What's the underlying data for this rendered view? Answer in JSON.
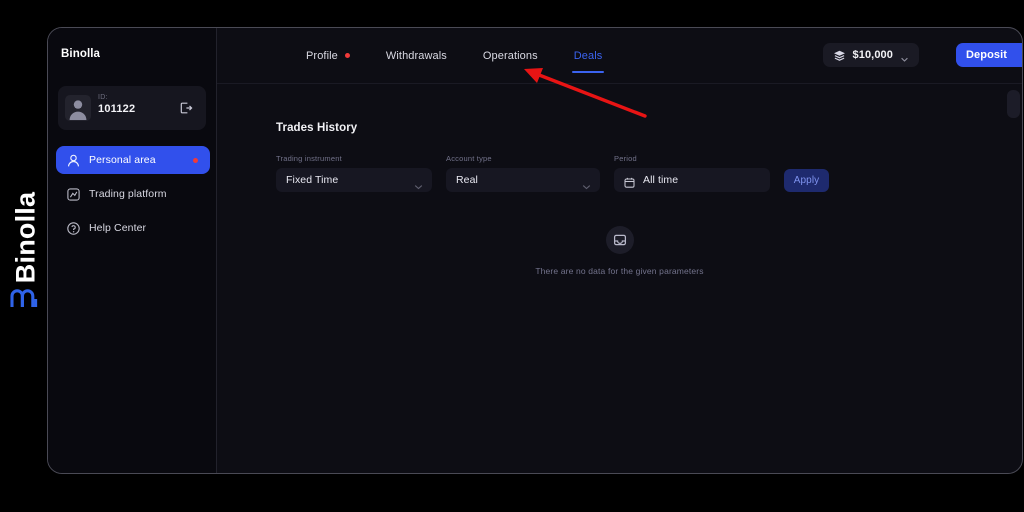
{
  "watermark": {
    "text": "Binolla",
    "logo_icon": "binolla-arch-logo"
  },
  "sidebar": {
    "brand": "Binolla",
    "account": {
      "id_label": "ID:",
      "id_value": "101122",
      "avatar_icon": "user-avatar-icon",
      "logout_icon": "logout-icon"
    },
    "items": [
      {
        "label": "Personal area",
        "icon": "person-icon",
        "active": true,
        "badge": true
      },
      {
        "label": "Trading platform",
        "icon": "chart-square-icon",
        "active": false,
        "badge": false
      },
      {
        "label": "Help Center",
        "icon": "question-circle-icon",
        "active": false,
        "badge": false
      }
    ]
  },
  "topbar": {
    "tabs": [
      {
        "label": "Profile",
        "active": false,
        "dot": true
      },
      {
        "label": "Withdrawals",
        "active": false,
        "dot": false
      },
      {
        "label": "Operations",
        "active": false,
        "dot": false
      },
      {
        "label": "Deals",
        "active": true,
        "dot": false
      }
    ],
    "balance": {
      "amount": "$10,000",
      "icon": "coins-stack-icon",
      "caret_icon": "chevron-down-icon"
    },
    "deposit_label": "Deposit"
  },
  "main": {
    "title": "Trades History",
    "filters": {
      "instrument": {
        "label": "Trading instrument",
        "value": "Fixed Time",
        "caret_icon": "chevron-down-icon"
      },
      "account_type": {
        "label": "Account type",
        "value": "Real",
        "caret_icon": "chevron-down-icon"
      },
      "period": {
        "label": "Period",
        "value": "All time",
        "calendar_icon": "calendar-icon"
      },
      "apply_label": "Apply"
    },
    "empty_state": {
      "icon": "inbox-tray-icon",
      "message": "There are no data for the given parameters"
    }
  },
  "annotation": {
    "arrow_icon": "red-arrow-pointing-to-deals-tab",
    "color": "#e81414"
  },
  "colors": {
    "accent_blue": "#3150ec",
    "tab_active": "#3b63f0",
    "badge_red": "#f03a3a",
    "app_bg": "#0d0d14",
    "sidebar_bg": "#09090f",
    "field_bg": "#171722",
    "apply_bg": "#1e2a6e"
  }
}
